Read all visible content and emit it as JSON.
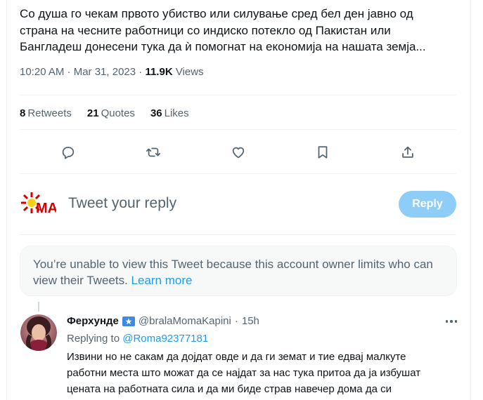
{
  "tweet": {
    "text": "Со душа го чекам првото убиство или силување сред бел ден јавно од\nстрана на чесните работници со индиско потекло од Пакистан или\nБангладеш донесени тука да ѝ помогнат на економија на нашата земја...",
    "time": "10:20 AM · Mar 31, 2023",
    "views_count": "11.9K",
    "views_label": "Views"
  },
  "stats": {
    "retweets_count": "8",
    "retweets_label": "Retweets",
    "quotes_count": "21",
    "quotes_label": "Quotes",
    "likes_count": "36",
    "likes_label": "Likes"
  },
  "actions": [
    "reply-icon",
    "retweet-icon",
    "like-icon",
    "bookmark-icon",
    "share-icon"
  ],
  "composer": {
    "avatar_text": "MA",
    "placeholder": "Tweet your reply",
    "reply_label": "Reply"
  },
  "notice": {
    "text": "You’re unable to view this Tweet because this account owner limits who can view their Tweets.",
    "link": "Learn more"
  },
  "reply": {
    "name": "Ферхунде",
    "handle": "@bralaMomaKapini",
    "time": "15h",
    "replying_prefix": "Replying to",
    "replying_to": "@Roma92377181",
    "text": "Извини но не сакам да дојдат овде и да ги земат  и тие едвај малкуте\nработни места што можат да се најдат за нас тука притоа да ја избушат\nцената на работната сила и да ми биде страв навечер дома да си"
  },
  "colors": {
    "accent": "#1d9bf0",
    "muted": "#536471",
    "reply_button": "#8ecdf8"
  }
}
